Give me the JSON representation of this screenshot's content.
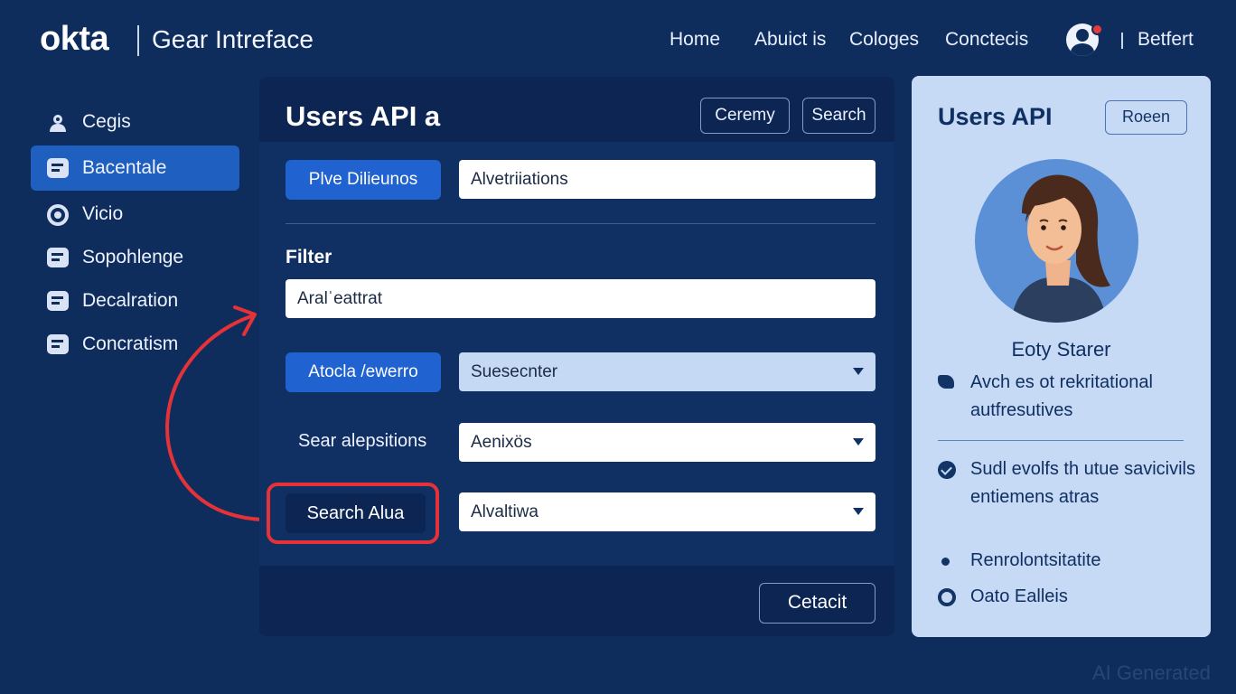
{
  "header": {
    "logo": "okta",
    "app_title": "Gear Intreface",
    "nav": [
      "Home",
      "Abuict is",
      "Cologes",
      "Conctecis"
    ],
    "user_link": "Betfert"
  },
  "sidebar": {
    "items": [
      {
        "label": "Cegis",
        "icon": "users-icon"
      },
      {
        "label": "Bacentale",
        "icon": "list-icon",
        "active": true
      },
      {
        "label": "Vicio",
        "icon": "target-icon"
      },
      {
        "label": "Sopohlenge",
        "icon": "card-icon"
      },
      {
        "label": "Decalration",
        "icon": "card-icon"
      },
      {
        "label": "Concratism",
        "icon": "card-icon"
      }
    ]
  },
  "main": {
    "title": "Users API a",
    "ceremony_button": "Ceremy",
    "search_button": "Search",
    "pive_button": "Plve Dilieunos",
    "top_input_value": "Alvetriiations",
    "filter_label": "Filter",
    "filter_input_value": "Aralˈeattrat",
    "atocla_button": "Atocla /ewerro",
    "select_1_value": "Suesecnter",
    "search_label": "Sear alepsitions",
    "select_2_value": "Aenixös",
    "search_alua_button": "Search Alua",
    "select_3_value": "Alvaltiwa",
    "footer_button": "Cetacit"
  },
  "profile": {
    "title": "Users API",
    "roeen_button": "Roeen",
    "name": "Eoty Starer",
    "bullets": [
      {
        "icon": "tag-icon",
        "text": "Avch es ot rekritational autfresutives"
      },
      {
        "icon": "check-circle-icon",
        "text": "Sudl evolfs th utue savicivils entiemens atras"
      },
      {
        "icon": "dot-icon",
        "text": "Renrolontsitatite"
      },
      {
        "icon": "target-icon",
        "text": "Oato Ealleis"
      }
    ]
  },
  "watermark": "AI Generated",
  "colors": {
    "background": "#0f2d5c",
    "accent": "#1f62d0",
    "highlight": "#e53238",
    "profile_panel": "#c6daf5"
  }
}
